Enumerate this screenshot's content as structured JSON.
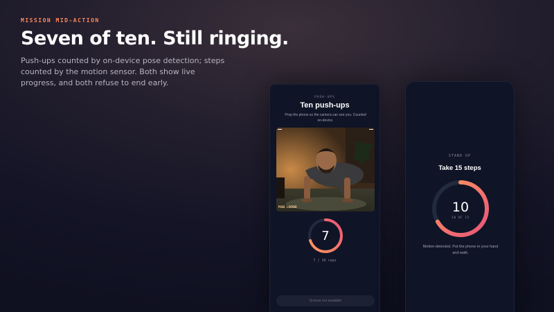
{
  "header": {
    "eyebrow": "MISSION MID-ACTION",
    "title": "Seven of ten. Still ringing.",
    "subtitle": "Push-ups counted by on-device pose detection; steps counted by the motion sensor. Both show live progress, and both refuse to end early."
  },
  "pushups_screen": {
    "label": "PUSH-UPS",
    "title": "Ten push-ups",
    "description": "Prop the phone so the camera can see you. Counted on-device.",
    "camera_badge": "POSE LOCKED",
    "count": "7",
    "target": 10,
    "progress_fraction": 0.7,
    "count_caption": "7 / 10 reps",
    "snooze_label": "Snooze not available"
  },
  "steps_screen": {
    "label": "STAND UP",
    "title": "Take 15 steps",
    "count": "10",
    "count_caption": "10 OF 15",
    "target": 15,
    "progress_fraction": 0.667,
    "description": "Motion-detected. Put the phone in your hand and walk."
  },
  "colors": {
    "accent_orange": "#ff8a5c",
    "accent_pink": "#e8537a",
    "track": "#222a3e",
    "background": "#141426"
  }
}
